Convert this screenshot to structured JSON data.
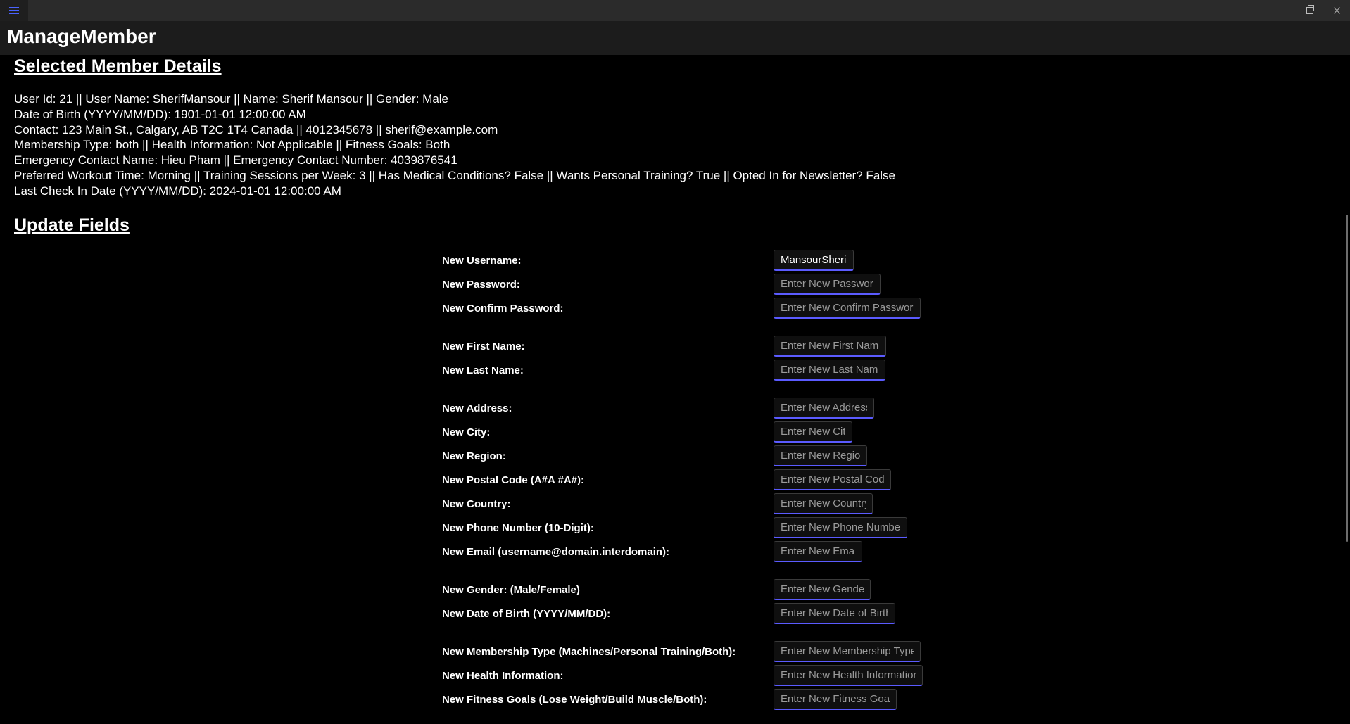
{
  "window": {
    "title": "ManageMember"
  },
  "details": {
    "heading": "Selected Member Details",
    "lines": [
      "User Id: 21 || User Name: SherifMansour || Name: Sherif Mansour || Gender: Male",
      "Date of Birth (YYYY/MM/DD): 1901-01-01 12:00:00 AM",
      "Contact: 123 Main St., Calgary, AB T2C 1T4 Canada || 4012345678 || sherif@example.com",
      "Membership Type: both || Health Information: Not Applicable || Fitness Goals: Both",
      "Emergency Contact Name: Hieu Pham || Emergency Contact Number: 4039876541",
      "Preferred Workout Time: Morning || Training Sessions per Week: 3 || Has Medical Conditions? False || Wants Personal Training? True || Opted In for Newsletter? False",
      "Last Check In Date (YYYY/MM/DD): 2024-01-01 12:00:00 AM"
    ]
  },
  "update": {
    "heading": "Update Fields",
    "fields": [
      {
        "label": "New Username:",
        "value": "MansourSherif",
        "placeholder": ""
      },
      {
        "label": "New Password:",
        "value": "",
        "placeholder": "Enter New Password"
      },
      {
        "label": "New Confirm Password:",
        "value": "",
        "placeholder": "Enter New Confirm Password"
      },
      {
        "label": "New First Name:",
        "value": "",
        "placeholder": "Enter New First Name"
      },
      {
        "label": "New Last Name:",
        "value": "",
        "placeholder": "Enter New Last Name"
      },
      {
        "label": "New Address:",
        "value": "",
        "placeholder": "Enter New Address"
      },
      {
        "label": "New City:",
        "value": "",
        "placeholder": "Enter New City"
      },
      {
        "label": "New Region:",
        "value": "",
        "placeholder": "Enter New Region"
      },
      {
        "label": "New Postal Code (A#A #A#):",
        "value": "",
        "placeholder": "Enter New Postal Code"
      },
      {
        "label": "New Country:",
        "value": "",
        "placeholder": "Enter New Country"
      },
      {
        "label": "New Phone Number (10-Digit):",
        "value": "",
        "placeholder": "Enter New Phone Number"
      },
      {
        "label": "New Email (username@domain.interdomain):",
        "value": "",
        "placeholder": "Enter New Email"
      },
      {
        "label": "New Gender: (Male/Female)",
        "value": "",
        "placeholder": "Enter New Gender"
      },
      {
        "label": "New Date of Birth (YYYY/MM/DD):",
        "value": "",
        "placeholder": "Enter New Date of Birth"
      },
      {
        "label": "New Membership Type (Machines/Personal Training/Both):",
        "value": "",
        "placeholder": "Enter New Membership Type"
      },
      {
        "label": "New Health Information:",
        "value": "",
        "placeholder": "Enter New Health Information"
      },
      {
        "label": "New Fitness Goals (Lose Weight/Build Muscle/Both):",
        "value": "",
        "placeholder": "Enter New Fitness Goals"
      }
    ]
  },
  "icons": {
    "menu": "hamburger-menu-icon",
    "minimize": "minimize-icon",
    "maximize": "restore-icon",
    "close": "close-icon"
  },
  "colors": {
    "accent": "#5b5bff",
    "background": "#000000",
    "titlebar": "#2b2b2b",
    "header": "#1c1c1c"
  }
}
